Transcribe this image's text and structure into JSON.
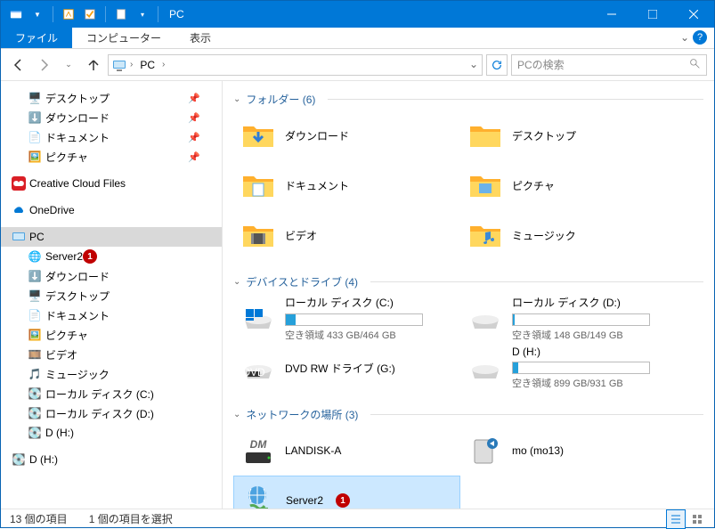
{
  "title": "PC",
  "ribbon": {
    "file": "ファイル",
    "computer": "コンピューター",
    "view": "表示"
  },
  "crumb": {
    "root": "PC"
  },
  "search": {
    "placeholder": "PCの検索"
  },
  "tree": {
    "quick": {
      "desktop": "デスクトップ",
      "downloads": "ダウンロード",
      "documents": "ドキュメント",
      "pictures": "ピクチャ"
    },
    "ccf": "Creative Cloud Files",
    "onedrive": "OneDrive",
    "pc": "PC",
    "pc_children": {
      "server2": "Server2",
      "downloads": "ダウンロード",
      "desktop": "デスクトップ",
      "documents": "ドキュメント",
      "pictures": "ピクチャ",
      "videos": "ビデオ",
      "music": "ミュージック",
      "disk_c": "ローカル ディスク (C:)",
      "disk_d": "ローカル ディスク (D:)",
      "disk_h1": "D (H:)",
      "disk_h2": "D (H:)"
    },
    "badge1": "1"
  },
  "groups": {
    "folders": {
      "title": "フォルダー (6)"
    },
    "drives": {
      "title": "デバイスとドライブ (4)"
    },
    "network": {
      "title": "ネットワークの場所 (3)"
    }
  },
  "folders": {
    "downloads": "ダウンロード",
    "desktop": "デスクトップ",
    "documents": "ドキュメント",
    "pictures": "ピクチャ",
    "videos": "ビデオ",
    "music": "ミュージック"
  },
  "drives": {
    "c": {
      "name": "ローカル ディスク (C:)",
      "sub": "空き領域 433 GB/464 GB",
      "pct": 7
    },
    "d": {
      "name": "ローカル ディスク (D:)",
      "sub": "空き領域 148 GB/149 GB",
      "pct": 1
    },
    "g": {
      "name": "DVD RW ドライブ (G:)"
    },
    "h": {
      "name": "D (H:)",
      "sub": "空き領域 899 GB/931 GB",
      "pct": 4
    }
  },
  "network": {
    "landisk": "LANDISK-A",
    "mo": "mo (mo13)",
    "server2": "Server2",
    "badge": "1"
  },
  "status": {
    "items": "13 個の項目",
    "selected": "1 個の項目を選択"
  }
}
